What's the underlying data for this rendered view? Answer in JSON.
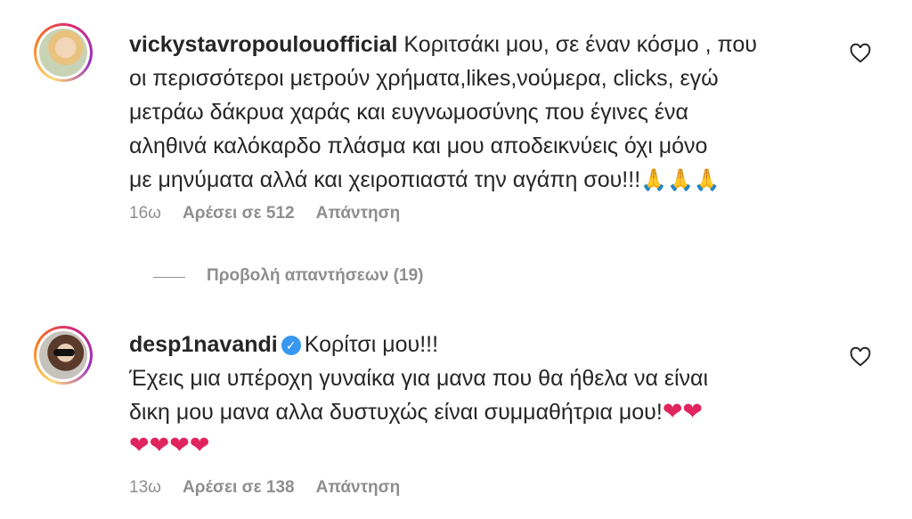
{
  "comments": [
    {
      "username": "vickystavropoulouofficial",
      "text_lines": [
        "Κοριτσάκι μου, σε έναν κόσμο , που",
        "οι περισσότεροι μετρούν χρήματα,likes,νούμερα, clicks, εγώ",
        "μετράω δάκρυα χαράς και ευγνωμοσύνης που έγινες ένα",
        "αληθινά καλόκαρδο πλάσμα και μου αποδεικνύεις όχι μόνο",
        "με μηνύματα αλλά και χειροπιαστά την αγάπη σου!!!"
      ],
      "emojis": "🙏🙏🙏",
      "time": "16ω",
      "likes": "Αρέσει σε 512",
      "reply": "Απάντηση"
    },
    {
      "username": "desp1navandi",
      "verified": true,
      "text_first": "Κορίτσι μου!!!",
      "text_lines": [
        "Έχεις μια υπέροχη γυναίκα για μανα που θα ήθελα να είναι",
        "δικη μου μανα αλλα δυστυχώς είναι συμμαθήτρια μου!"
      ],
      "hearts_inline": "❤❤",
      "hearts_line": "❤❤❤❤",
      "time": "13ω",
      "likes": "Αρέσει σε 138",
      "reply": "Απάντηση"
    }
  ],
  "view_replies": "Προβολή απαντήσεων (19)",
  "icons": {
    "like": "heart-outline-icon",
    "verified": "verified-badge-icon"
  },
  "colors": {
    "text": "#262626",
    "secondary": "#8e8e8e",
    "verified": "#3897f0"
  }
}
